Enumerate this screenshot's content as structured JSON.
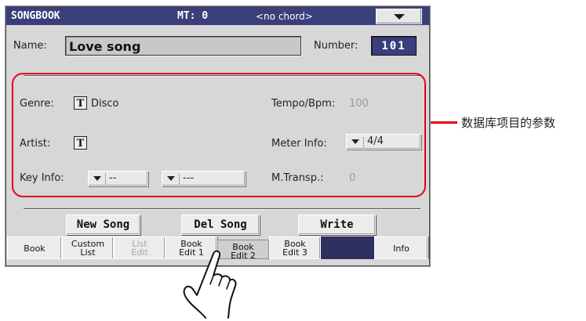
{
  "title_bar": {
    "page_name": "SONGBOOK",
    "mt": "MT: 0",
    "chord": "<no chord>",
    "menu_icon": "chevron-down-icon"
  },
  "name": {
    "label": "Name:",
    "value": "Love song"
  },
  "number": {
    "label": "Number:",
    "value": "101"
  },
  "fields": {
    "genre": {
      "label": "Genre:",
      "value": "Disco"
    },
    "artist": {
      "label": "Artist:",
      "value": ""
    },
    "key_info": {
      "label": "Key Info:",
      "value1": "--",
      "value2": "---"
    },
    "tempo": {
      "label": "Tempo/Bpm:",
      "value": "100"
    },
    "meter": {
      "label": "Meter Info:",
      "value": "4/4"
    },
    "mtransp": {
      "label": "M.Transp.:",
      "value": "0"
    },
    "text_icon_label": "T"
  },
  "buttons": {
    "new_song": "New Song",
    "del_song": "Del Song",
    "write": "Write"
  },
  "tabs": {
    "book": "Book",
    "custom_list": [
      "Custom",
      "List"
    ],
    "list_edit": [
      "List",
      "Edit"
    ],
    "book_edit_1": [
      "Book",
      "Edit 1"
    ],
    "book_edit_2": [
      "Book",
      "Edit 2"
    ],
    "book_edit_3": [
      "Book",
      "Edit 3"
    ],
    "info": "Info"
  },
  "annotation": "数据库项目的参数",
  "colors": {
    "title_bar": "#3a3f7c",
    "highlight": "#e2001a",
    "screen_bg": "#d7d7d7"
  },
  "overlay_icon": "pointing-hand-icon"
}
